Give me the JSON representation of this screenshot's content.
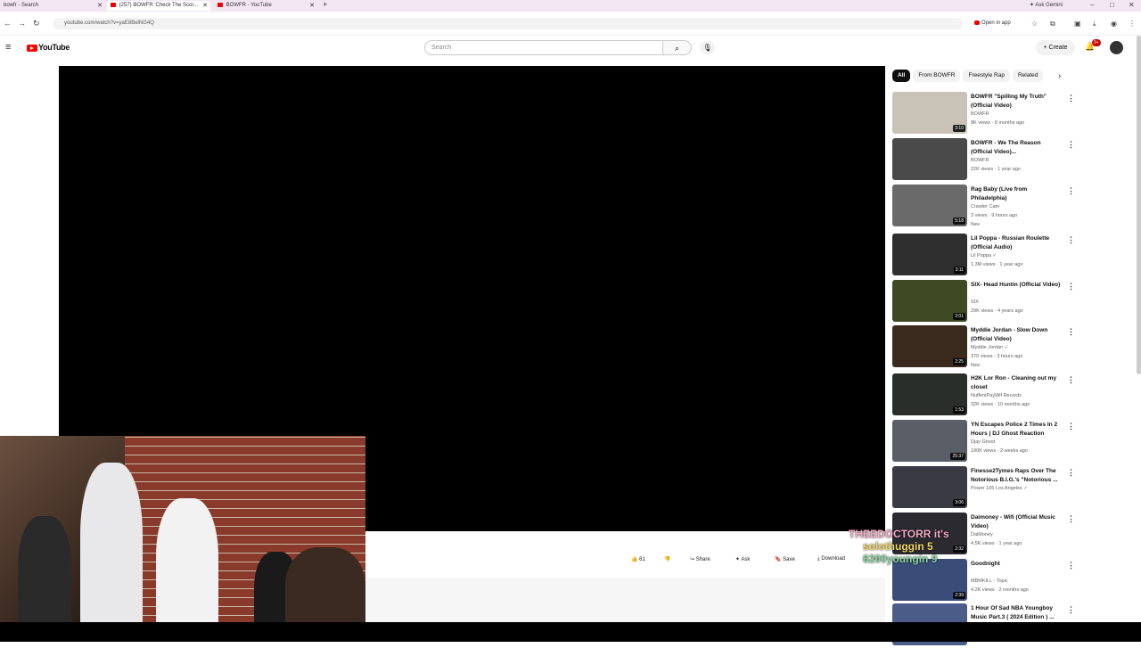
{
  "browser": {
    "tabs": [
      {
        "label": "bowfr - Search",
        "active": false
      },
      {
        "label": "(257) BOWFR 'Check The Scor...",
        "active": true
      },
      {
        "label": "BOWFR - YouTube",
        "active": false
      }
    ],
    "gemini_label": "Ask Gemini",
    "url": "youtube.com/watch?v=yaE8BelNG4Q",
    "open_in_app_label": "Open in app"
  },
  "header": {
    "logo_text": "YouTube",
    "search_placeholder": "Search",
    "create_label": "Create",
    "notification_count": "9+"
  },
  "actions": {
    "like_count": "61",
    "share_label": "Share",
    "ask_label": "Ask",
    "save_label": "Save",
    "download_label": "Download"
  },
  "chips": [
    "All",
    "From BOWFR",
    "Freestyle Rap",
    "Related"
  ],
  "recommendations": [
    {
      "title": "BOWFR \"Spilling My Truth\"(Official Video)",
      "channel": "BOWFR",
      "meta": "8K views · 8 months ago",
      "duration": "3:10",
      "new": ""
    },
    {
      "title": "BOWFR - We The Reason (Official Video)...",
      "channel": "BOWFR",
      "meta": "22K views · 1 year ago",
      "duration": "",
      "new": ""
    },
    {
      "title": "Rag Baby (Live from Philadelphia)",
      "channel": "Crawler Cam",
      "meta": "3 views · 9 hours ago",
      "duration": "5:18",
      "new": "New"
    },
    {
      "title": "Lil Poppa - Russian Roulette (Official Audio)",
      "channel": "Lil Poppa ✓",
      "meta": "1.3M views · 1 year ago",
      "duration": "3:11",
      "new": ""
    },
    {
      "title": "SIX- Head Huntin (Official Video)",
      "channel": "SIX",
      "meta": "29K views · 4 years ago",
      "duration": "2:01",
      "new": ""
    },
    {
      "title": "Myddie Jordan - Slow Down (Official Video)",
      "channel": "Myddie Jordan ✓",
      "meta": "370 views · 3 hours ago",
      "duration": "2:25",
      "new": "New"
    },
    {
      "title": "H2K Lor Ron - Cleaning out my closet",
      "channel": "NuffentPayWif Records",
      "meta": "32K views · 10 months ago",
      "duration": "1:53",
      "new": ""
    },
    {
      "title": "YN Escapes Police 2 Times In 2 Hours | DJ Ghost Reaction",
      "channel": "Djay Ghost",
      "meta": "190K views · 2 weeks ago",
      "duration": "25:37",
      "new": ""
    },
    {
      "title": "Finesse2Tymes Raps Over The Notorious B.I.G.'s \"Notorious ...",
      "channel": "Power 105 Los Angeles ✓",
      "meta": "",
      "duration": "3:06",
      "new": ""
    },
    {
      "title": "Daimoney - Wifi (Official Music Video)",
      "channel": "DaiMoney",
      "meta": "4.5K views · 1 year ago",
      "duration": "2:32",
      "new": ""
    },
    {
      "title": "Goodnight",
      "channel": "MBMKILL - Topic",
      "meta": "4.2K views · 2 months ago",
      "duration": "2:39",
      "new": ""
    },
    {
      "title": "1 Hour Of Sad NBA Youngboy Music Part.3 ( 2024 Edition ) ...",
      "channel": "",
      "meta": "",
      "duration": "",
      "new": ""
    }
  ],
  "overlay_chat": [
    {
      "text": "THEEDOCTORR it's",
      "color": "#f4a7c3"
    },
    {
      "text": "solothuggin 5",
      "color": "#f0d860"
    },
    {
      "text": "6200youngin 9",
      "color": "#8ad6a0"
    }
  ],
  "colors": {
    "brand_red": "#ff0000",
    "player_bg": "#000000"
  }
}
